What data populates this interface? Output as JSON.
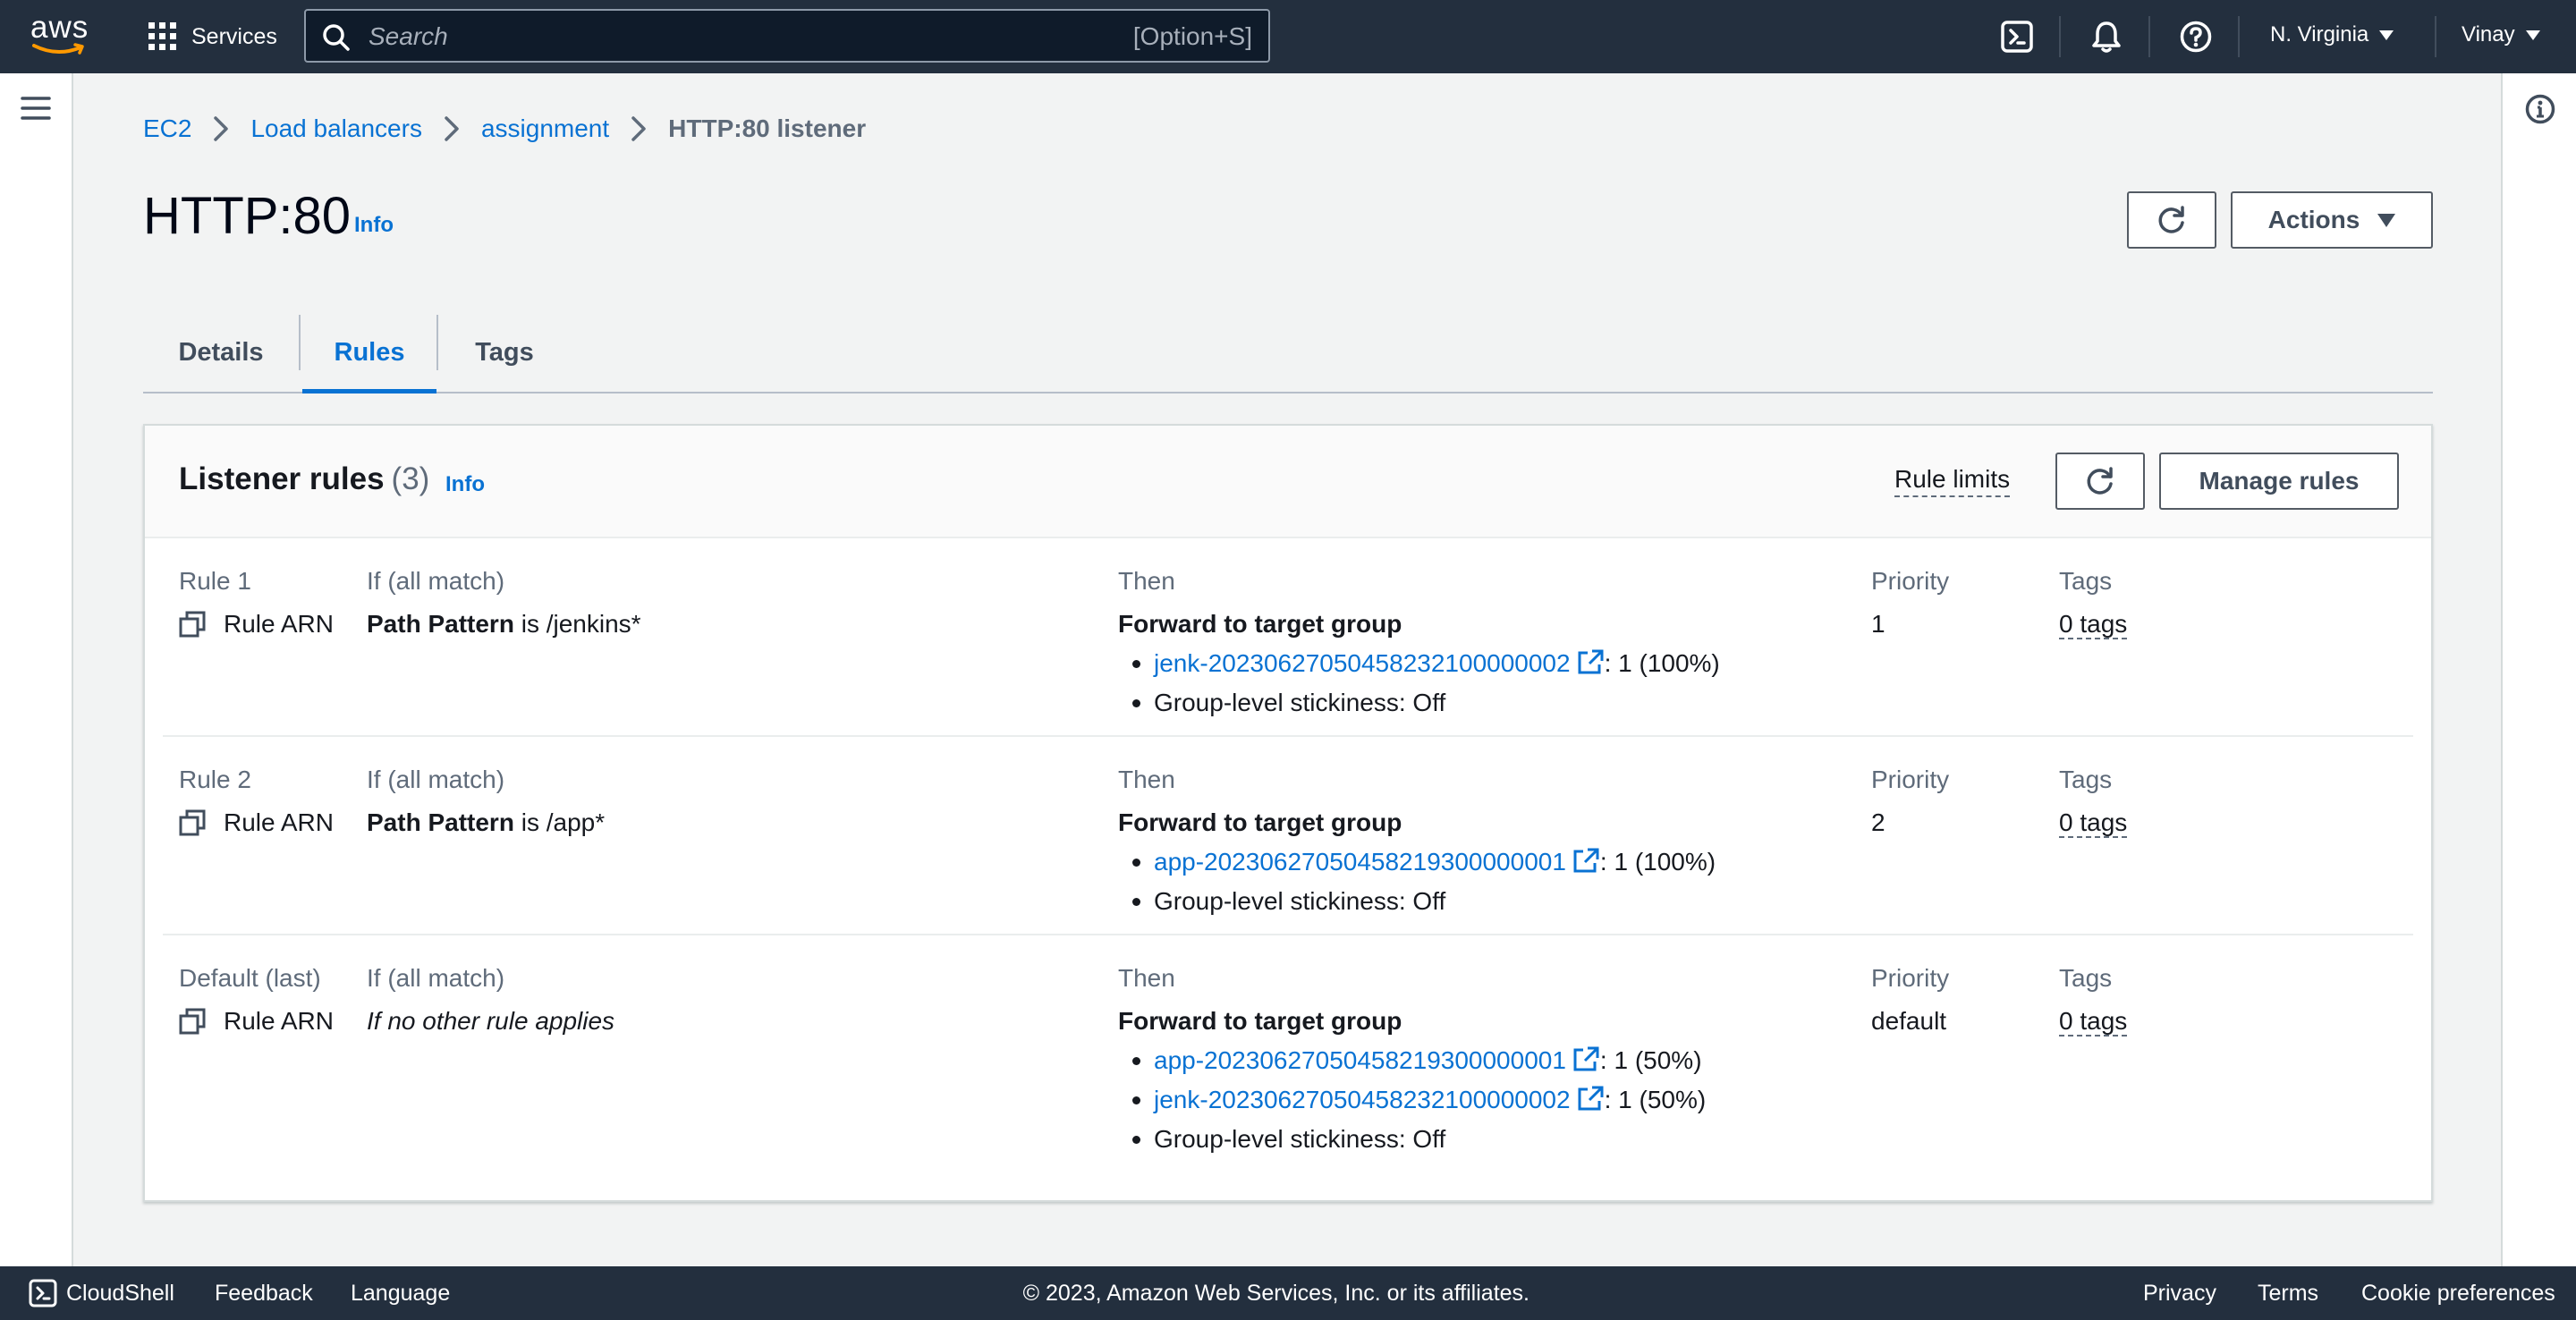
{
  "topnav": {
    "logo_text": "aws",
    "services_label": "Services",
    "search_placeholder": "Search",
    "search_shortcut": "[Option+S]",
    "region": "N. Virginia",
    "user": "Vinay"
  },
  "breadcrumb": {
    "items": [
      "EC2",
      "Load balancers",
      "assignment"
    ],
    "current": "HTTP:80 listener"
  },
  "page": {
    "title": "HTTP:80",
    "info": "Info",
    "actions_label": "Actions"
  },
  "tabs": [
    "Details",
    "Rules",
    "Tags"
  ],
  "active_tab": "Rules",
  "listener_rules": {
    "title": "Listener rules",
    "count": "(3)",
    "info": "Info",
    "rule_limits": "Rule limits",
    "manage_rules": "Manage rules",
    "rules": [
      {
        "name": "Rule 1",
        "arn_label": "Rule ARN",
        "condition_header": "If (all match)",
        "condition_field": "Path Pattern",
        "condition_rest": " is /jenkins*",
        "then_header": "Then",
        "action": "Forward to target group",
        "targets": [
          {
            "name": "jenk-20230627050458232100000002",
            "weight": ": 1 (100%)"
          }
        ],
        "stickiness": "Group-level stickiness: Off",
        "priority_header": "Priority",
        "priority": "1",
        "tags_header": "Tags",
        "tags": "0 tags"
      },
      {
        "name": "Rule 2",
        "arn_label": "Rule ARN",
        "condition_header": "If (all match)",
        "condition_field": "Path Pattern",
        "condition_rest": " is /app*",
        "then_header": "Then",
        "action": "Forward to target group",
        "targets": [
          {
            "name": "app-20230627050458219300000001",
            "weight": ": 1 (100%)"
          }
        ],
        "stickiness": "Group-level stickiness: Off",
        "priority_header": "Priority",
        "priority": "2",
        "tags_header": "Tags",
        "tags": "0 tags"
      },
      {
        "name": "Default (last)",
        "arn_label": "Rule ARN",
        "condition_header": "If (all match)",
        "condition_text": "If no other rule applies",
        "then_header": "Then",
        "action": "Forward to target group",
        "targets": [
          {
            "name": "app-20230627050458219300000001",
            "weight": ": 1 (50%)"
          },
          {
            "name": "jenk-20230627050458232100000002",
            "weight": ": 1 (50%)"
          }
        ],
        "stickiness": "Group-level stickiness: Off",
        "priority_header": "Priority",
        "priority": "default",
        "tags_header": "Tags",
        "tags": "0 tags"
      }
    ]
  },
  "footer": {
    "cloudshell": "CloudShell",
    "feedback": "Feedback",
    "language": "Language",
    "copyright": "© 2023, Amazon Web Services, Inc. or its affiliates.",
    "privacy": "Privacy",
    "terms": "Terms",
    "cookies": "Cookie preferences"
  },
  "colors": {
    "nav_bg": "#232f3e",
    "link": "#0972d3",
    "aws_orange": "#ff9900"
  }
}
